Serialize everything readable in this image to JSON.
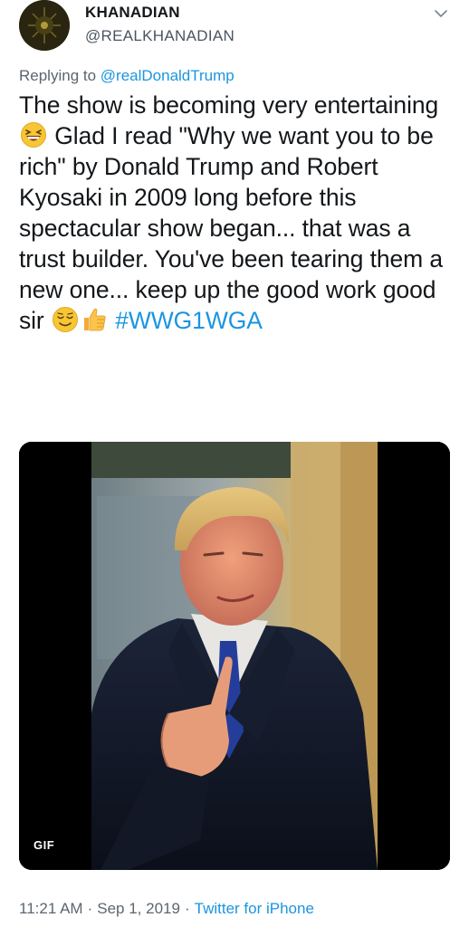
{
  "user": {
    "display_name": "KHANADIAN",
    "handle": "@REALKHANADIAN"
  },
  "reply": {
    "prefix": "Replying to ",
    "mention": "@realDonaldTrump"
  },
  "tweet": {
    "text_part1": "The show is becoming very entertaining ",
    "text_part2": " Glad I read \"Why we want you to be rich\" by Donald Trump and Robert Kyosaki in 2009 long before this spectacular show began... that was a trust builder. You've been tearing them a new one... keep up the good work good sir ",
    "hashtag": "#WWG1WGA",
    "emojis": [
      "grinning-squinting-face-icon",
      "relieved-face-icon",
      "thumbs-up-icon"
    ]
  },
  "media": {
    "badge": "GIF"
  },
  "meta": {
    "time": "11:21 AM",
    "date": "Sep 1, 2019",
    "separator": "·",
    "source": "Twitter for iPhone"
  },
  "colors": {
    "link": "#1b95e0",
    "text": "#14171a",
    "secondary": "#5b6670"
  }
}
